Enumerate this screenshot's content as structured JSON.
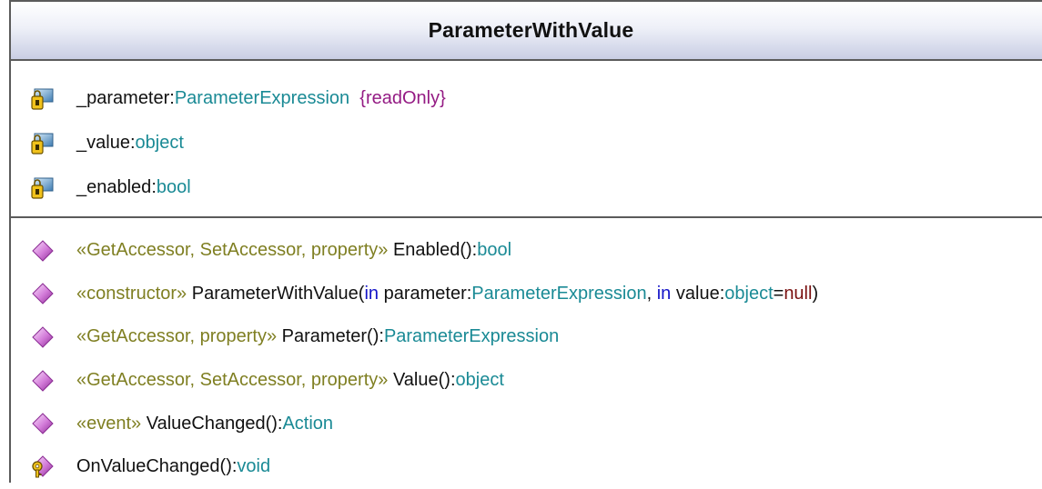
{
  "class_name": "ParameterWithValue",
  "attributes": [
    {
      "name": "_parameter",
      "sep": ":",
      "type": "ParameterExpression",
      "constraint": "{readOnly}",
      "icon": "private-field-lock-icon"
    },
    {
      "name": "_value",
      "sep": ":",
      "type": "object",
      "icon": "private-field-lock-icon"
    },
    {
      "name": "_enabled",
      "sep": ":",
      "type": "bool",
      "icon": "private-field-lock-icon"
    }
  ],
  "operations": [
    {
      "stereotype": "«GetAccessor, SetAccessor, property»",
      "name": "Enabled()",
      "sep": ":",
      "type": "bool",
      "icon": "public-method-diamond-icon"
    },
    {
      "stereotype": "«constructor»",
      "name": "ParameterWithValue(",
      "kw1": "in",
      "p1": "parameter",
      "p1sep": ":",
      "p1type": "ParameterExpression",
      "comma": ", ",
      "kw2": "in",
      "p2": "value",
      "p2sep": ":",
      "p2type": "object",
      "p2eq": "=",
      "p2default": "null",
      "close": ")",
      "icon": "public-method-diamond-icon"
    },
    {
      "stereotype": "«GetAccessor, property»",
      "name": "Parameter()",
      "sep": ":",
      "type": "ParameterExpression",
      "icon": "public-method-diamond-icon"
    },
    {
      "stereotype": "«GetAccessor, SetAccessor, property»",
      "name": "Value()",
      "sep": ":",
      "type": "object",
      "icon": "public-method-diamond-icon"
    },
    {
      "stereotype": "«event»",
      "name": "ValueChanged()",
      "sep": ":",
      "type": "Action",
      "icon": "public-method-diamond-icon"
    },
    {
      "stereotype": "",
      "name": "OnValueChanged()",
      "sep": ":",
      "type": "void",
      "icon": "protected-method-key-icon"
    }
  ],
  "colors": {
    "type": "#1a8a95",
    "stereotype": "#7f7f22",
    "constraint": "#941b84",
    "keyword": "#1414c8",
    "method_icon": "#d27ad8",
    "field_icon": "#4f86b8"
  }
}
